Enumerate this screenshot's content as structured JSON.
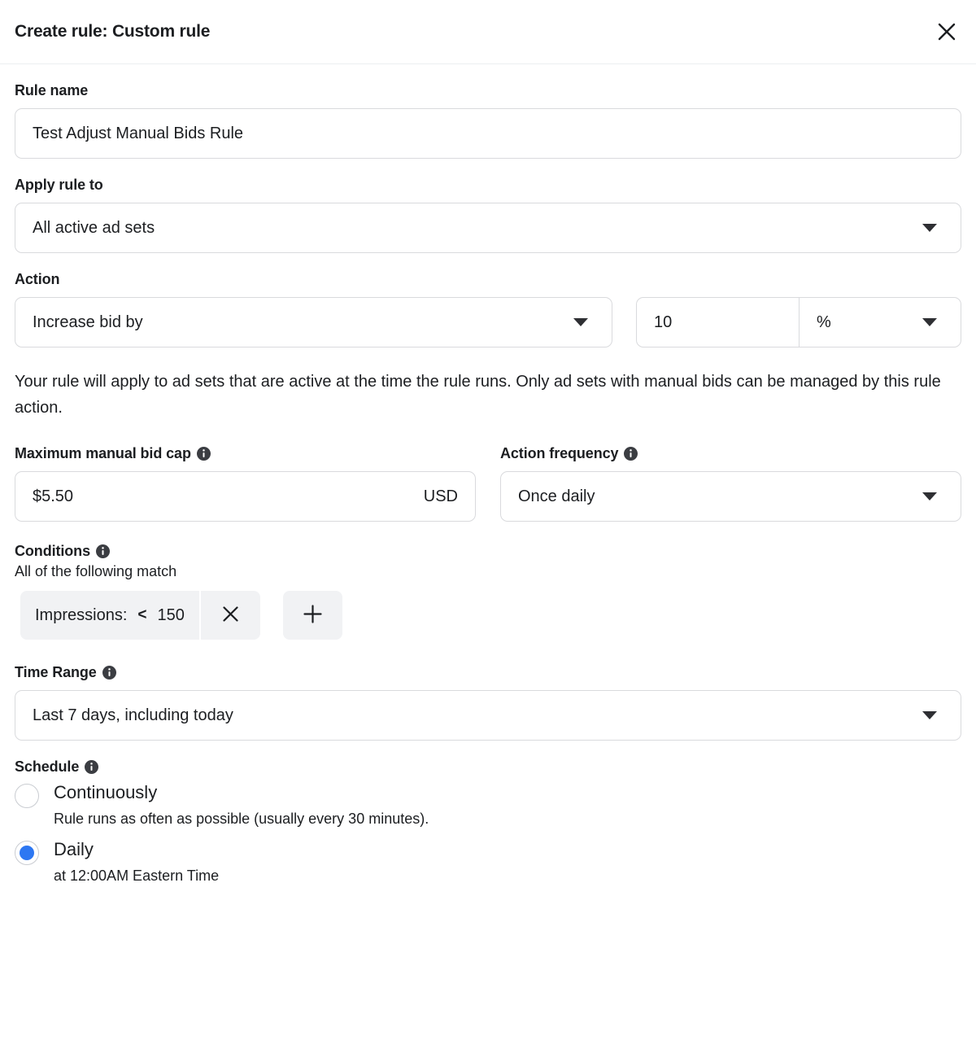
{
  "header": {
    "title": "Create rule: Custom rule",
    "close_label": "Close"
  },
  "rule_name": {
    "label": "Rule name",
    "value": "Test Adjust Manual Bids Rule",
    "placeholder": "Rule name"
  },
  "apply_rule_to": {
    "label": "Apply rule to",
    "value": "All active ad sets"
  },
  "action": {
    "label": "Action",
    "type_value": "Increase bid by",
    "amount_value": "10",
    "amount_placeholder": "0",
    "unit_value": "%"
  },
  "helper": {
    "text": "Your rule will apply to ad sets that are active at the time the rule runs. Only ad sets with manual bids can be managed by this rule action."
  },
  "bid_cap": {
    "label": "Maximum manual bid cap",
    "value": "$5.50",
    "placeholder": "$0.00",
    "currency": "USD"
  },
  "action_frequency": {
    "label": "Action frequency",
    "value": "Once daily"
  },
  "conditions": {
    "label": "Conditions",
    "subtext": "All of the following match",
    "chip": {
      "metric": "Impressions:",
      "operator": "<",
      "value": "150"
    },
    "remove_label": "Remove condition",
    "add_label": "Add condition"
  },
  "time_range": {
    "label": "Time Range",
    "value": "Last 7 days, including today"
  },
  "schedule": {
    "label": "Schedule",
    "options": [
      {
        "label": "Continuously",
        "description": "Rule runs as often as possible (usually every 30 minutes).",
        "selected": false
      },
      {
        "label": "Daily",
        "description": "at 12:00AM Eastern Time",
        "selected": true
      }
    ]
  },
  "colors": {
    "accent": "#2d77f2",
    "border": "#d9dadd",
    "chip_bg": "#f1f2f4",
    "text": "#1c1e21"
  }
}
